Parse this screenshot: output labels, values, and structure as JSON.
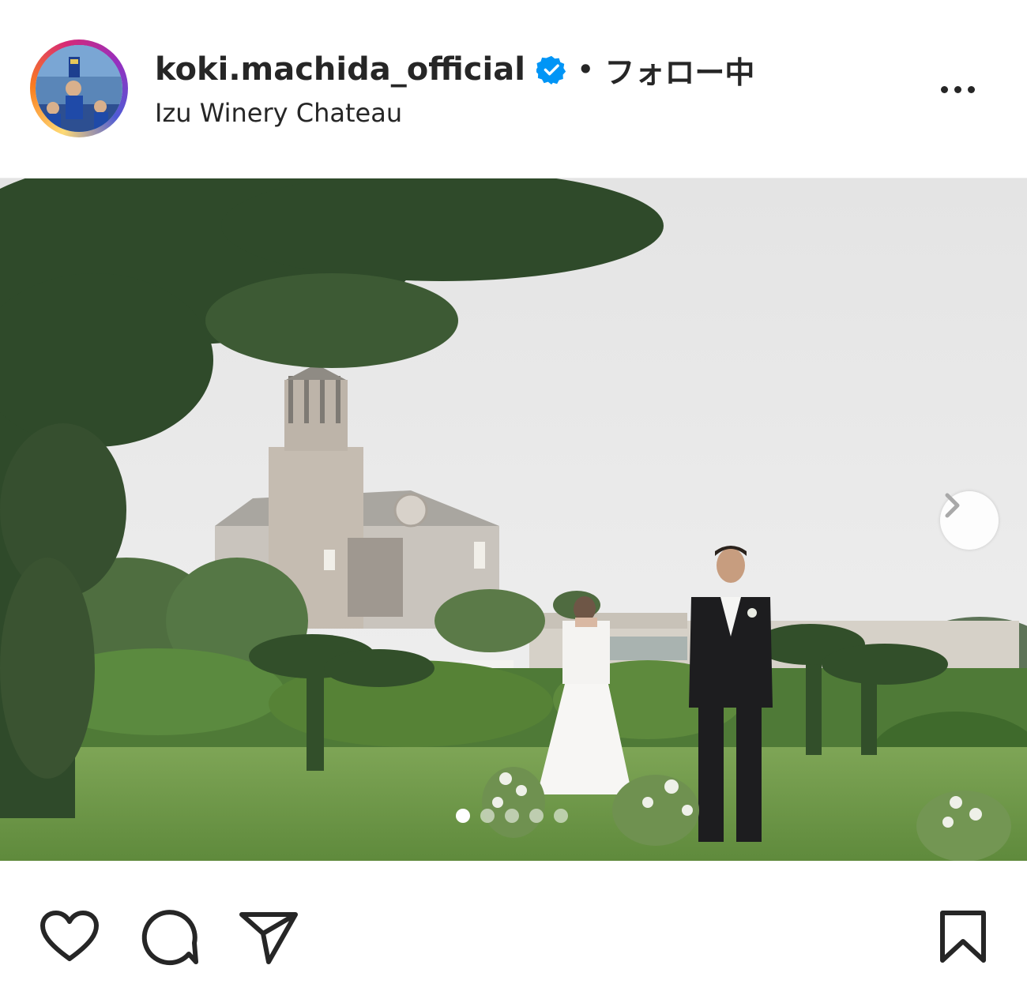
{
  "post": {
    "username": "koki.machida_official",
    "separator": "•",
    "follow_status": "フォロー中",
    "location": "Izu Winery Chateau",
    "more_icon": "more-horizontal-icon",
    "verified_icon": "verified-badge-icon"
  },
  "carousel": {
    "slide_count": 5,
    "active_index": 1,
    "next_icon": "chevron-right-icon"
  },
  "actions": {
    "like_icon": "heart-icon",
    "comment_icon": "comment-icon",
    "share_icon": "paper-plane-icon",
    "save_icon": "bookmark-icon"
  },
  "colors": {
    "verified": "#0095f6",
    "text": "#262626",
    "grass": "#6f9a4a",
    "sky": "#e9e9ea"
  }
}
